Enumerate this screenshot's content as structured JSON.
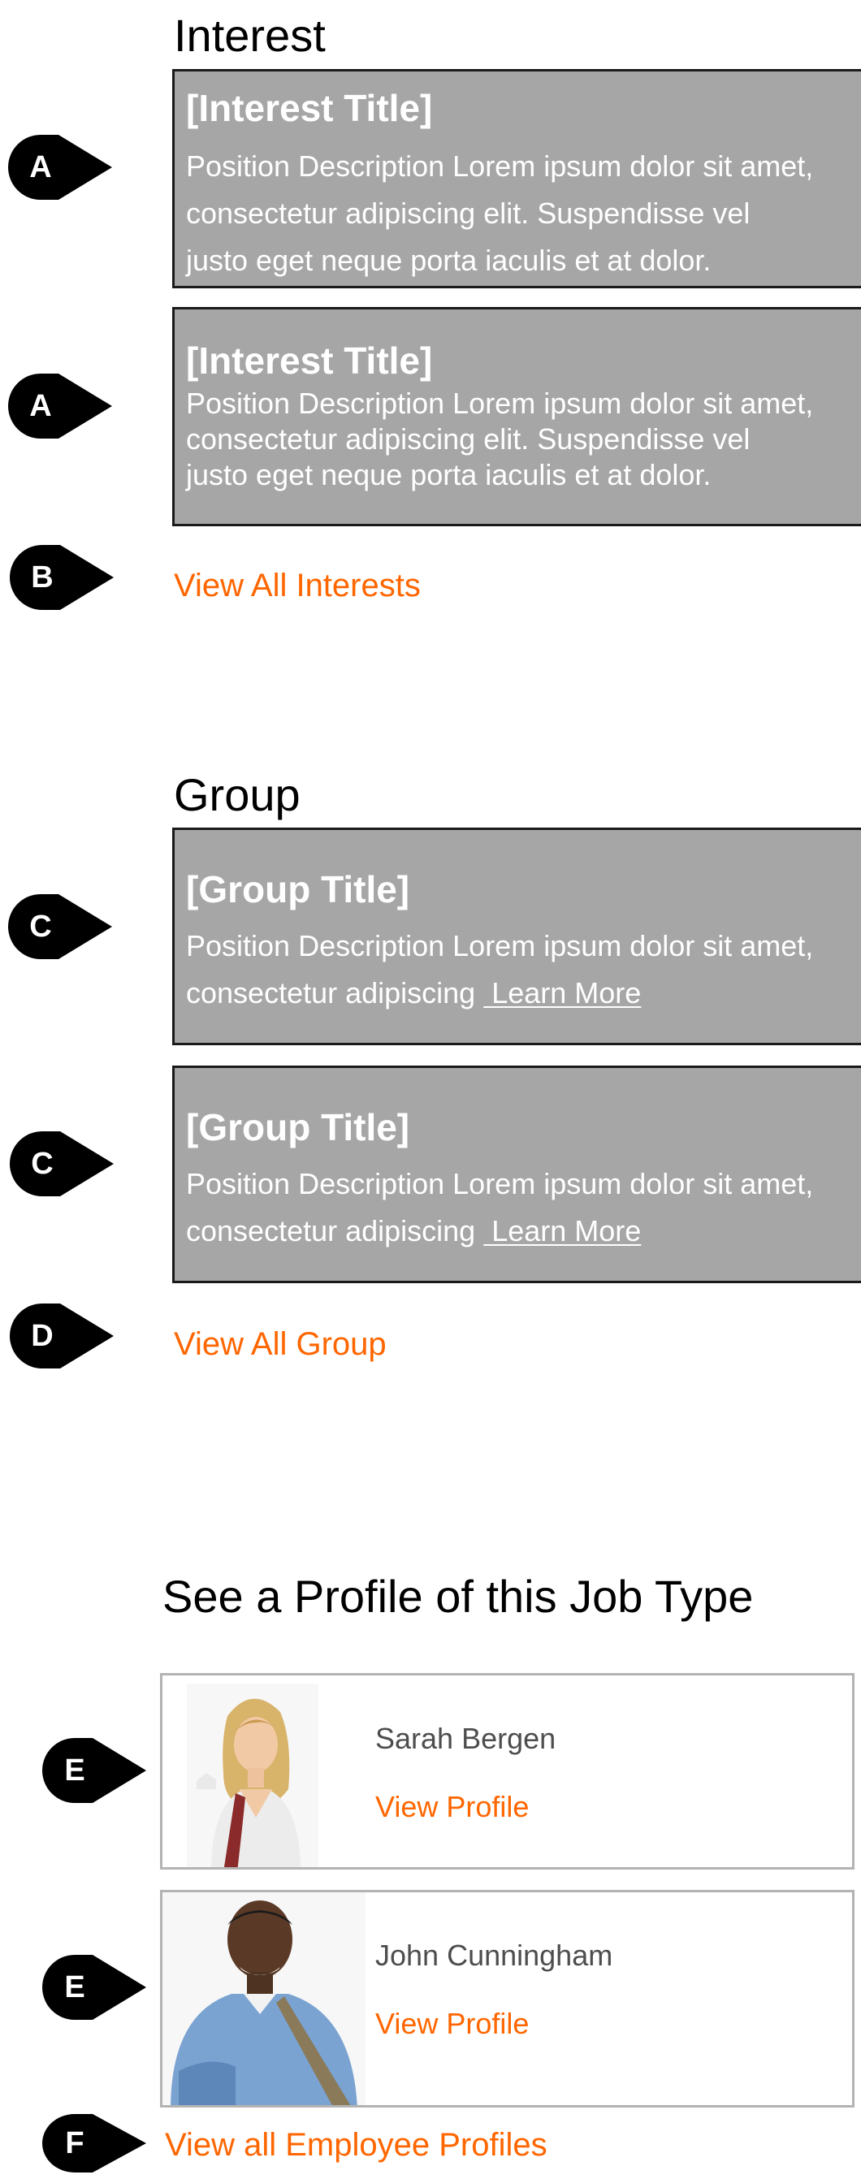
{
  "colors": {
    "card_background": "#a6a6a6",
    "card_border": "#1a1a1a",
    "link_orange": "#ff6600",
    "marker_black": "#000000",
    "profile_border": "#b3b3b3",
    "profile_name": "#4d4d4d"
  },
  "interest": {
    "heading": "Interest",
    "cards": [
      {
        "marker": "A",
        "title": "[Interest Title]",
        "lines": [
          "Position Description Lorem ipsum dolor sit amet,",
          "consectetur adipiscing elit. Suspendisse vel",
          "justo eget neque porta iaculis et at dolor."
        ]
      },
      {
        "marker": "A",
        "title": "[Interest Title]",
        "lines": [
          "Position Description Lorem ipsum dolor sit amet,",
          "consectetur adipiscing elit. Suspendisse vel",
          "justo eget neque porta iaculis et at dolor."
        ]
      }
    ],
    "view_all": {
      "marker": "B",
      "label": "View All Interests"
    }
  },
  "group": {
    "heading": "Group",
    "cards": [
      {
        "marker": "C",
        "title": "[Group Title]",
        "line1": "Position Description Lorem ipsum dolor sit amet,",
        "line2": "consectetur adipiscing ",
        "learn_more": " Learn More"
      },
      {
        "marker": "C",
        "title": "[Group Title]",
        "line1": "Position Description Lorem ipsum dolor sit amet,",
        "line2": "consectetur adipiscing ",
        "learn_more": " Learn More"
      }
    ],
    "view_all": {
      "marker": "D",
      "label": "View All Group"
    }
  },
  "profiles": {
    "heading": "See a Profile of this Job Type",
    "items": [
      {
        "marker": "E",
        "name": "Sarah Bergen",
        "link": "View Profile",
        "photo_icon": "female-employee-photo"
      },
      {
        "marker": "E",
        "name": "John Cunningham",
        "link": "View Profile",
        "photo_icon": "male-employee-photo"
      }
    ],
    "view_all": {
      "marker": "F",
      "label": "View all Employee Profiles"
    }
  }
}
